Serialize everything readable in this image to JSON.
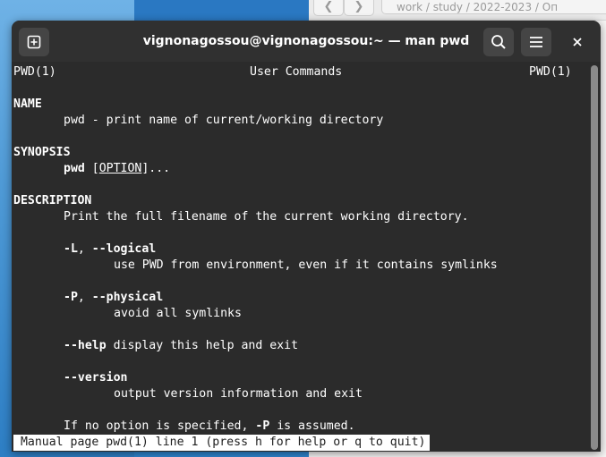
{
  "background_window": {
    "path": "work / study / 2022-2023 / Оп"
  },
  "terminal": {
    "title": "vignonagossou@vignonagossou:~ — man pwd",
    "header_left": "PWD(1)",
    "header_center": "User Commands",
    "header_right": "PWD(1)",
    "name_heading": "NAME",
    "name_desc": "pwd - print name of current/working directory",
    "synopsis_heading": "SYNOPSIS",
    "synopsis_cmd": "pwd",
    "synopsis_opt": "OPTION",
    "synopsis_open": " [",
    "synopsis_close": "]...",
    "description_heading": "DESCRIPTION",
    "description_text": "Print the full filename of the current working directory.",
    "opt_L": "-L",
    "opt_L_sep": ", ",
    "opt_L_long": "--logical",
    "opt_L_desc": "use PWD from environment, even if it contains symlinks",
    "opt_P": "-P",
    "opt_P_sep": ", ",
    "opt_P_long": "--physical",
    "opt_P_desc": "avoid all symlinks",
    "opt_help": "--help",
    "opt_help_desc": " display this help and exit",
    "opt_version": "--version",
    "opt_version_desc": "output version information and exit",
    "footer_pre": "If no option is specified, ",
    "footer_opt": "-P",
    "footer_post": " is assumed.",
    "status": " Manual page pwd(1) line 1 (press h for help or q to quit)"
  },
  "colors": {
    "terminal_bg": "#2b2b2b",
    "titlebar_bg": "#303030",
    "text": "#ffffff",
    "status_bg": "#ffffff"
  },
  "icons": [
    "new-tab-icon",
    "search-icon",
    "menu-icon",
    "close-icon",
    "back-arrow-icon",
    "forward-arrow-icon"
  ]
}
